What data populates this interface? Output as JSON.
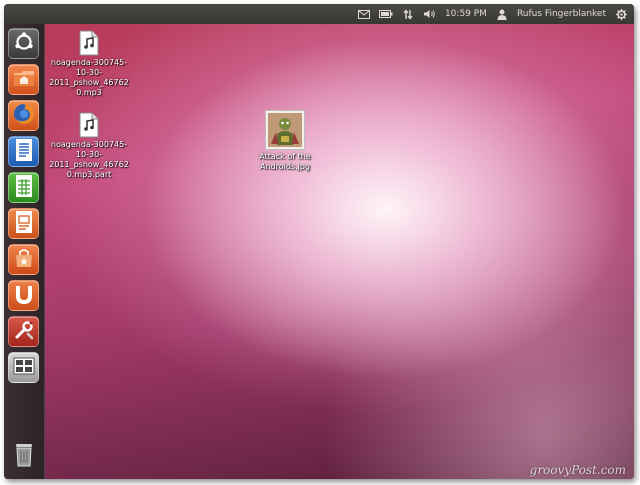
{
  "top_panel": {
    "clock": "10:59 PM",
    "user_name": "Rufus Fingerblanket",
    "tray_icons": [
      "mail-icon",
      "battery-icon",
      "network-icon",
      "volume-icon",
      "user-icon",
      "gear-icon"
    ]
  },
  "launcher": {
    "items": [
      {
        "name": "dash-home",
        "icon": "ubuntu-logo-icon",
        "color": "#505050"
      },
      {
        "name": "home-folder",
        "icon": "folder-icon",
        "color": "#e2662e"
      },
      {
        "name": "firefox",
        "icon": "firefox-icon",
        "color": "#e8661d"
      },
      {
        "name": "libreoffice-writer",
        "icon": "writer-icon",
        "color": "#2b6cc4"
      },
      {
        "name": "libreoffice-calc",
        "icon": "calc-icon",
        "color": "#3d9d2a"
      },
      {
        "name": "libreoffice-impress",
        "icon": "impress-icon",
        "color": "#d8692d"
      },
      {
        "name": "software-center",
        "icon": "shopping-bag-icon",
        "color": "#e35b26"
      },
      {
        "name": "ubuntu-one",
        "icon": "ubuntu-one-icon",
        "color": "#e05a26"
      },
      {
        "name": "system-settings",
        "icon": "wrench-icon",
        "color": "#c43a2a"
      },
      {
        "name": "workspace-switcher",
        "icon": "workspaces-icon",
        "color": "#9a9a9a"
      }
    ],
    "trash": {
      "icon": "trash-icon"
    }
  },
  "desktop": {
    "files": [
      {
        "label": "noagenda-300745-10-30-2011_pshow_467620.mp3",
        "icon": "mp3-file-icon",
        "badge": "mp3"
      },
      {
        "label": "noagenda-300745-10-30-2011_pshow_467620.mp3.part",
        "icon": "mp3-file-icon",
        "badge": "mp3"
      },
      {
        "label": "Attack of the Androids.jpg",
        "icon": "image-thumbnail-icon"
      }
    ]
  },
  "watermark": "groovyPost.com",
  "colors": {
    "panel": "#3c3b37",
    "launcher": "#34292e",
    "desktop_accent": "#c2497a"
  }
}
